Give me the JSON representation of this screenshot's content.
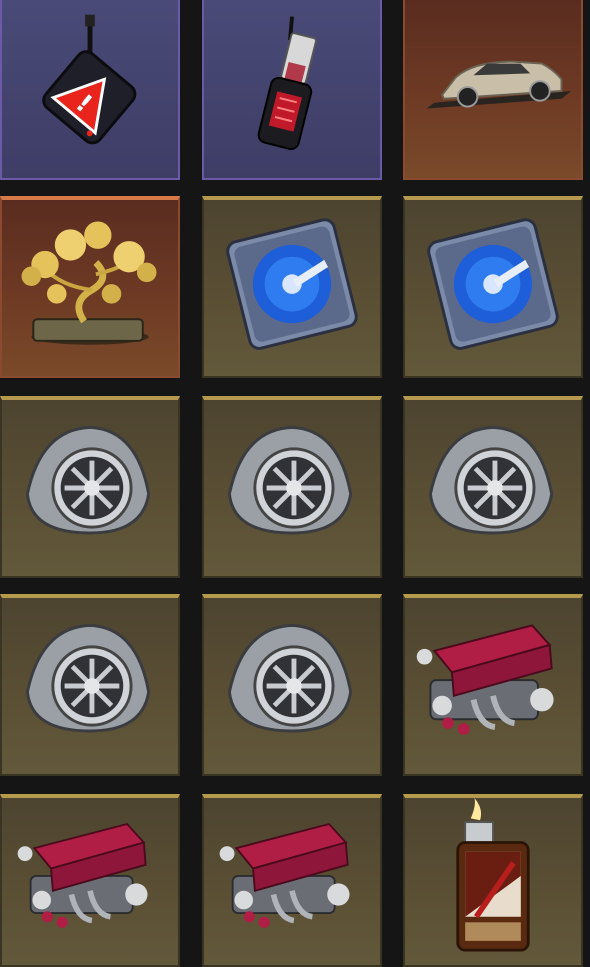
{
  "colors": {
    "background": "#151515",
    "purple_rarity": "#6a5aa8",
    "bronze_rarity": "#d77a4a",
    "gold_rarity": "#b59a4e"
  },
  "inventory": {
    "items": [
      {
        "icon": "warning-tag-icon",
        "rarity": "purple"
      },
      {
        "icon": "usb-dongle-icon",
        "rarity": "purple"
      },
      {
        "icon": "silver-sports-car-icon",
        "rarity": "bronze"
      },
      {
        "icon": "golden-bonsai-tree-icon",
        "rarity": "bronze"
      },
      {
        "icon": "blue-disk-icon",
        "rarity": "gold"
      },
      {
        "icon": "blue-disk-icon",
        "rarity": "gold"
      },
      {
        "icon": "rotary-engine-icon",
        "rarity": "gold"
      },
      {
        "icon": "rotary-engine-icon",
        "rarity": "gold"
      },
      {
        "icon": "rotary-engine-icon",
        "rarity": "gold"
      },
      {
        "icon": "rotary-engine-icon",
        "rarity": "gold"
      },
      {
        "icon": "rotary-engine-icon",
        "rarity": "gold"
      },
      {
        "icon": "red-engine-block-icon",
        "rarity": "gold"
      },
      {
        "icon": "red-engine-block-icon",
        "rarity": "gold"
      },
      {
        "icon": "red-engine-block-icon",
        "rarity": "gold"
      },
      {
        "icon": "lighter-icon",
        "rarity": "gold"
      }
    ]
  }
}
